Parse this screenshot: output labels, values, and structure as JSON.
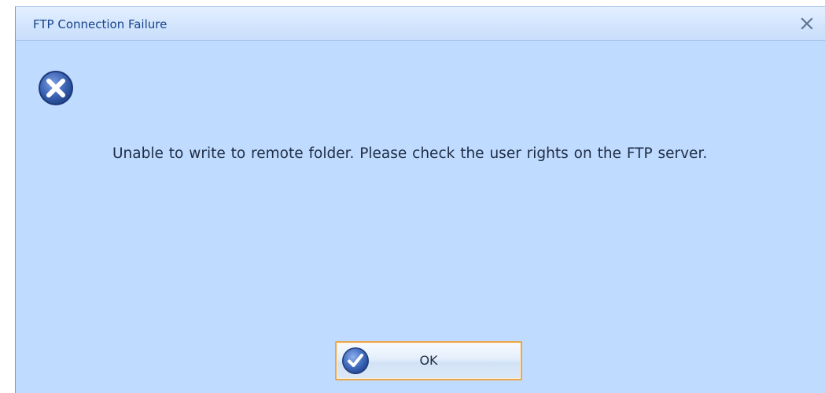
{
  "dialog": {
    "title": "FTP Connection Failure",
    "close_icon": "close-icon",
    "status_icon": "error-icon",
    "message": "Unable to write to remote folder. Please check the user rights on the FTP server.",
    "ok_button": {
      "label": "OK",
      "icon": "checkmark-icon"
    }
  },
  "colors": {
    "body_background": "#bfdbff",
    "title_text": "#15428b",
    "button_border": "#eaa54f",
    "icon_blue": "#3a63b5"
  }
}
